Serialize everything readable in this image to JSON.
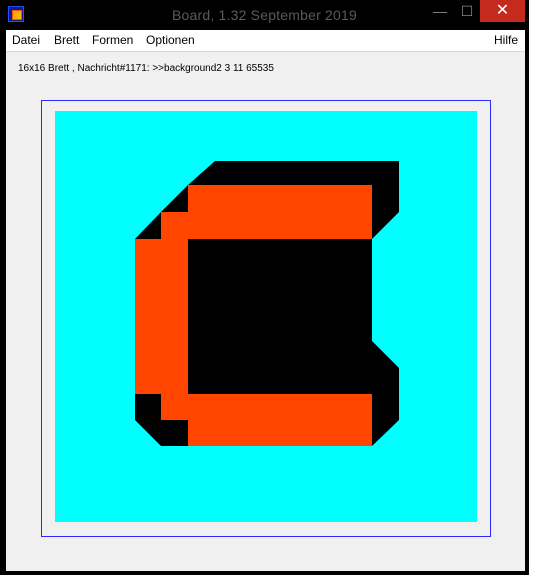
{
  "window": {
    "title": "Board, 1.32   September 2019",
    "controls": {
      "minimize": "—",
      "maximize": "☐",
      "close": "✕"
    }
  },
  "menu": {
    "left": [
      "Datei",
      "Brett",
      "Formen",
      "Optionen"
    ],
    "right": "Hilfe"
  },
  "status": {
    "text": "16x16 Brett , Nachricht#1171: >>background2 3 11 65535"
  },
  "board": {
    "grid": "16x16",
    "colors": {
      "background": "#00ffff",
      "shape": "#ff4500",
      "shadow": "#000000",
      "frame": "#2b2bff"
    }
  }
}
